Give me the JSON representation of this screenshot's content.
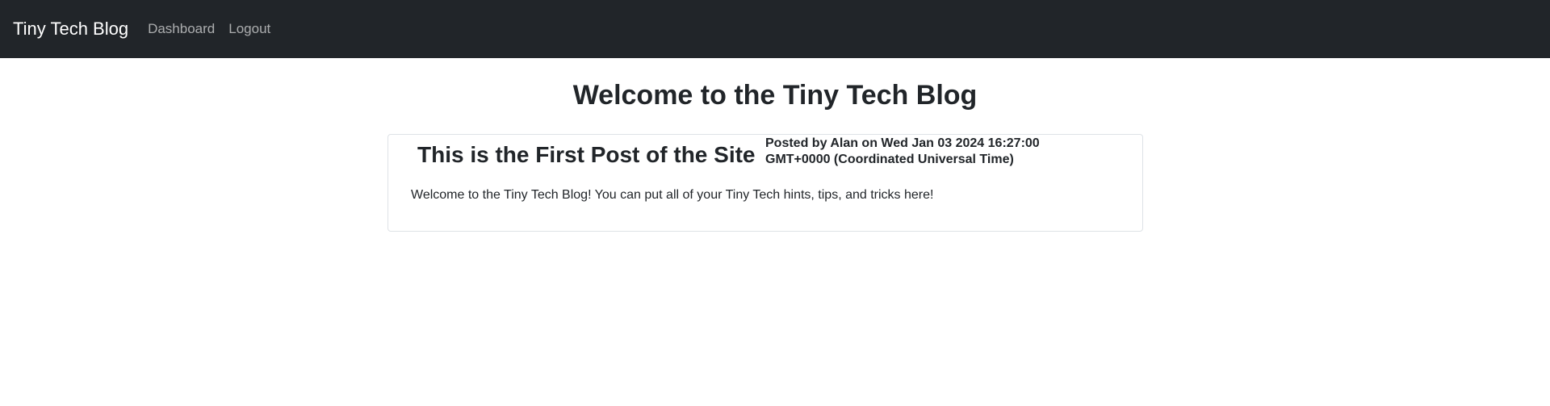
{
  "navbar": {
    "brand": "Tiny Tech Blog",
    "links": [
      {
        "label": "Dashboard"
      },
      {
        "label": "Logout"
      }
    ]
  },
  "main": {
    "title": "Welcome to the Tiny Tech Blog",
    "posts": [
      {
        "title": "This is the First Post of the Site",
        "meta": "Posted by Alan on Wed Jan 03 2024 16:27:00 GMT+0000 (Coordinated Universal Time)",
        "body": "Welcome to the Tiny Tech Blog! You can put all of your Tiny Tech hints, tips, and tricks here!"
      }
    ]
  },
  "colors": {
    "navbar_bg": "#212529",
    "text": "#212529",
    "card_border": "#dee2e6"
  }
}
